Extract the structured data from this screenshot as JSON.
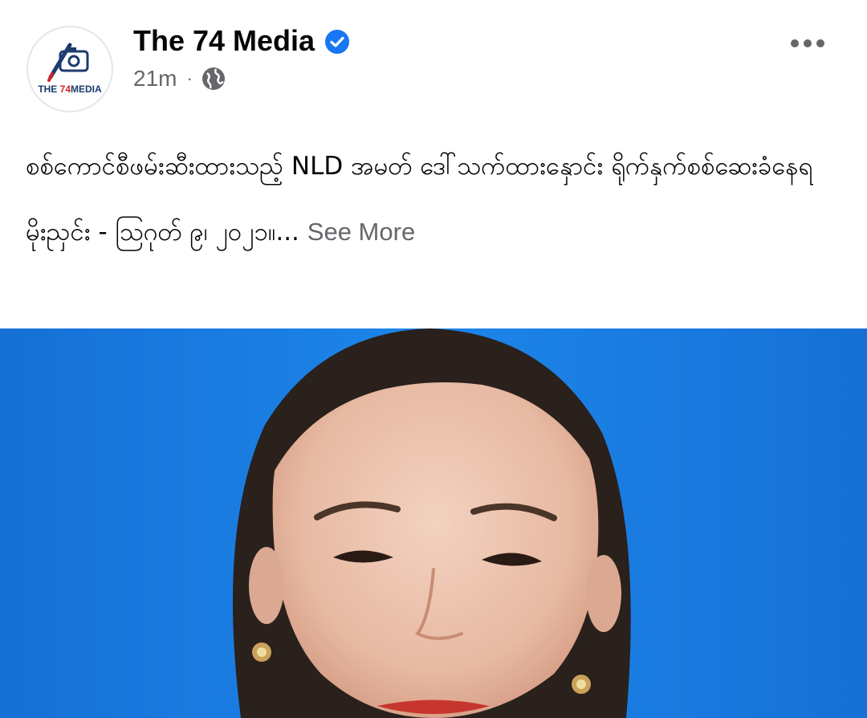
{
  "post": {
    "page_name": "The 74 Media",
    "verified_icon": "verified-badge-icon",
    "time_ago": "21m",
    "separator": "·",
    "audience_icon": "globe-icon",
    "more_icon": "more-options-icon",
    "avatar": {
      "logo_text_main": "THE ",
      "logo_text_accent": "74",
      "logo_text_tail": "MEDIA"
    },
    "text": {
      "line1": "စစ်ကောင်စီဖမ်းဆီးထားသည့် NLD အမတ် ဒေါ်သက်ထားနှောင်း ရိုက်နှက်စစ်ဆေးခံနေရ",
      "line2": "မိုးညှင်း - ဩဂုတ် ၉၊ ၂၀၂၁။...",
      "see_more": "See More"
    },
    "photo": {
      "description_icon": "portrait-photo"
    }
  },
  "colors": {
    "verified_blue": "#1877f2",
    "secondary_text": "#65676b",
    "photo_background": "#1a7fe0"
  }
}
